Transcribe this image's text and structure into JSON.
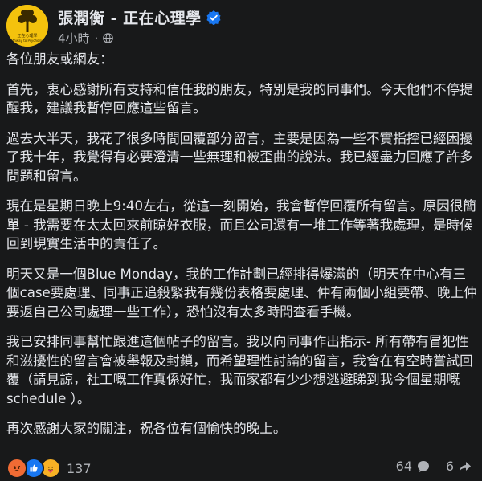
{
  "header": {
    "page_name": "張潤衡 - 正在心理學",
    "timestamp": "4小時",
    "separator": "·",
    "avatar_text": "正在心理學",
    "avatar_subtext": "Pathway to Psychology",
    "verified_color": "#1877f2"
  },
  "post": {
    "paragraphs": [
      "各位朋友或網友：",
      "首先，衷心感謝所有支持和信任我的朋友，特別是我的同事們。今天他們不停提醒我，建議我暫停回應這些留言。",
      "過去大半天，我花了很多時間回覆部分留言，主要是因為一些不實指控已經困擾了我十年，我覺得有必要澄清一些無理和被歪曲的說法。我已經盡力回應了許多問題和留言。",
      "現在是星期日晚上9:40左右，從這一刻開始，我會暫停回覆所有留言。原因很簡單 - 我需要在太太回來前晾好衣服，而且公司還有一堆工作等著我處理，是時候回到現實生活中的責任了。",
      "明天又是一個Blue Monday，我的工作計劃已經排得爆滿的（明天在中心有三個case要處理、同事正追殺緊我有幾份表格要處理、仲有兩個小組要帶、晚上仲要返自己公司處理一些工作），恐怕沒有太多時間查看手機。",
      "我已安排同事幫忙跟進這個帖子的留言。我以向同事作出指示- 所有帶有冒犯性和滋擾性的留言會被舉報及封鎖，而希望理性討論的留言，我會在有空時嘗試回覆（請見諒，社工嘅工作真係好忙，我而家都有少少想逃避睇到我今個星期嘅schedule ）。",
      "再次感謝大家的關注，祝各位有個愉快的晚上。"
    ]
  },
  "footer": {
    "reaction_icons": [
      "angry-icon",
      "like-icon",
      "care-icon"
    ],
    "reaction_count": "137",
    "comment_count": "64",
    "share_count": "6"
  }
}
